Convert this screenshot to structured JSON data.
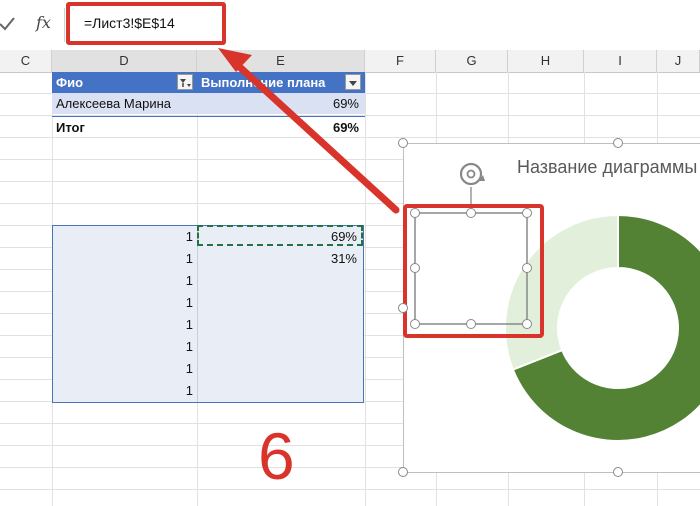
{
  "formula_bar": {
    "fx_label": "fx",
    "formula": "=Лист3!$E$14"
  },
  "columns": {
    "c": "C",
    "d": "D",
    "e": "E",
    "f": "F",
    "g": "G",
    "h": "H",
    "i": "I",
    "j": "J"
  },
  "pivot": {
    "header_fio": "Фио",
    "header_plan": "Выполнение плана",
    "row_name": "Алексеева Марина",
    "row_value": "69%",
    "total_label": "Итог",
    "total_value": "69%"
  },
  "data_block": {
    "d_values": [
      "1",
      "1",
      "1",
      "1",
      "1",
      "1",
      "1",
      "1"
    ],
    "e_values": [
      "69%",
      "31%"
    ]
  },
  "chart": {
    "title": "Название диаграммы",
    "slices": [
      {
        "value": 69,
        "color": "#548235"
      },
      {
        "value": 31,
        "color": "#e2efda"
      }
    ]
  },
  "annotation": {
    "step_number": "6",
    "color": "#d9342b"
  }
}
